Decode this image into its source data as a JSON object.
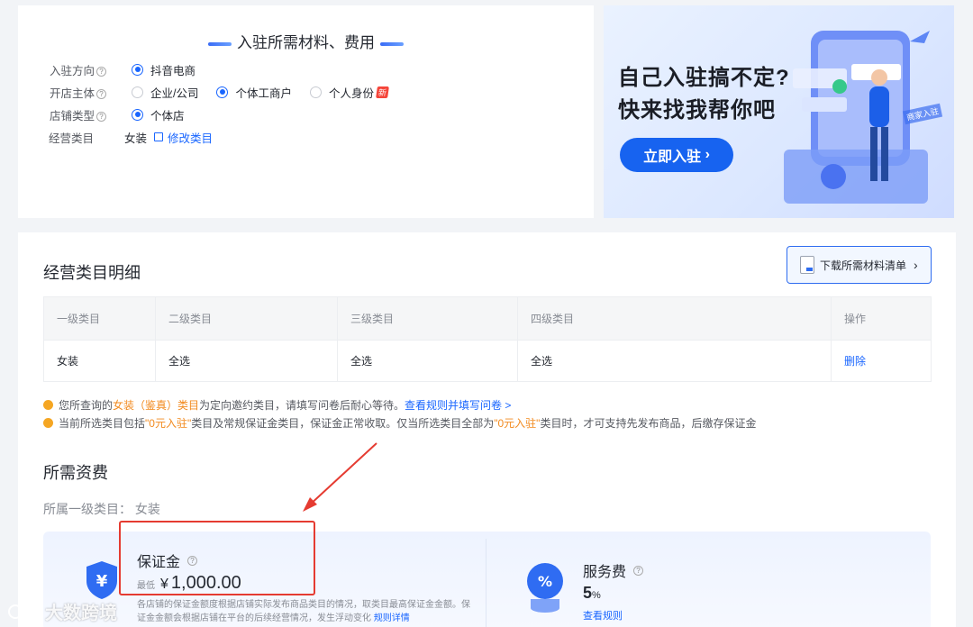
{
  "entry_card": {
    "title": "入驻所需材料、费用",
    "rows": {
      "direction": {
        "label": "入驻方向",
        "options": [
          "抖音电商"
        ]
      },
      "subject": {
        "label": "开店主体",
        "options": [
          "企业/公司",
          "个体工商户",
          "个人身份"
        ],
        "new_badge": "新",
        "selected": "个体工商户"
      },
      "store_type": {
        "label": "店铺类型",
        "options": [
          "个体店"
        ]
      },
      "category": {
        "label": "经营类目",
        "value": "女装",
        "edit_link": "修改类目"
      }
    }
  },
  "banner": {
    "line1": "自己入驻搞不定?",
    "line2": "快来找我帮你吧",
    "button": "立即入驻",
    "tag": "商家入驻"
  },
  "category_detail": {
    "title": "经营类目明细",
    "download_button": "下载所需材料清单",
    "columns": [
      "一级类目",
      "二级类目",
      "三级类目",
      "四级类目",
      "操作"
    ],
    "rows": [
      [
        "女装",
        "全选",
        "全选",
        "全选",
        "删除"
      ]
    ],
    "note1": {
      "p1": "您所查询的",
      "hl": "女装（鉴真）类目",
      "p2": "为定向邀约类目，请填写问卷后耐心等待。",
      "link": "查看规则并填写问卷 >"
    },
    "note2": {
      "p1": "当前所选类目包括",
      "hl1": "\"0元入驻\"",
      "p2": "类目及常规保证金类目，保证金正常收取。仅当所选类目全部为",
      "hl2": "\"0元入驻\"",
      "p3": "类目时，才可支持先发布商品，后缴存保证金"
    }
  },
  "fees": {
    "title": "所需资费",
    "primary_category": "所属一级类目：  女装",
    "deposit": {
      "title": "保证金",
      "min_label": "最低",
      "currency": "¥",
      "amount": "1,000.00",
      "desc": "各店铺的保证金额度根据店铺实际发布商品类目的情况，取类目最高保证金金额。保证金金额会根据店铺在平台的后续经营情况，发生浮动变化",
      "rule_link": "规则详情"
    },
    "service": {
      "title": "服务费",
      "rate": "5",
      "unit": "%",
      "link": "查看规则"
    }
  },
  "watermark": "大数跨境",
  "colors": {
    "primary": "#1966ff",
    "warning": "#f28a1e",
    "highlight_box": "#e53b31"
  }
}
